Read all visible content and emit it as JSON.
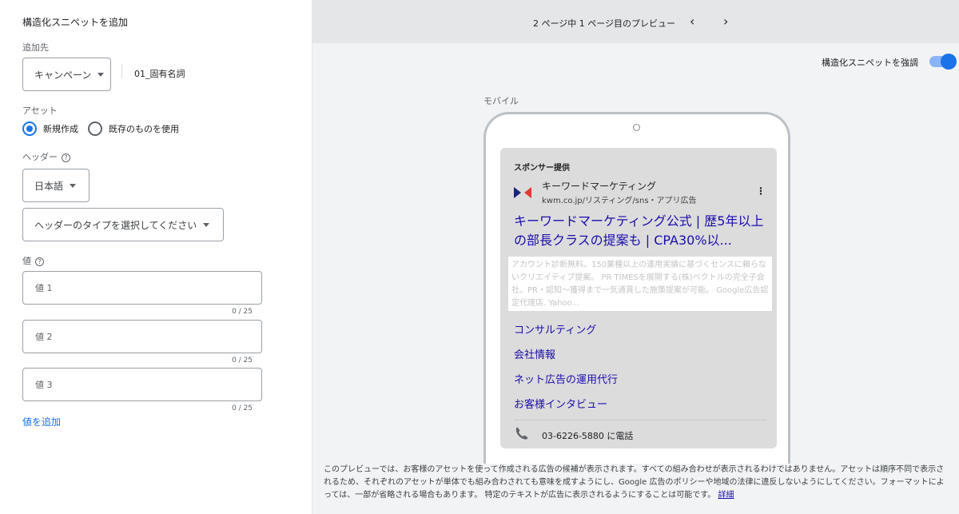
{
  "left": {
    "title": "構造化スニペットを追加",
    "destination_label": "追加先",
    "destination_dropdown": "キャンペーン",
    "campaign_name": "01_固有名詞",
    "asset_label": "アセット",
    "radio_new": "新規作成",
    "radio_existing": "既存のものを使用",
    "header_label": "ヘッダー",
    "language": "日本語",
    "header_type_placeholder": "ヘッダーのタイプを選択してください",
    "value_label": "値",
    "values": [
      {
        "placeholder": "値 1",
        "counter": "0 / 25"
      },
      {
        "placeholder": "値 2",
        "counter": "0 / 25"
      },
      {
        "placeholder": "値 3",
        "counter": "0 / 25"
      }
    ],
    "add_value": "値を追加"
  },
  "preview": {
    "page_text": "2 ページ中 1 ページ目のプレビュー",
    "prev_icon": "chevron-left-icon",
    "next_icon": "chevron-right-icon",
    "toggle_label": "構造化スニペットを強調",
    "toggle_on": true,
    "mobile_label": "モバイル",
    "ad": {
      "sponsored": "スポンサー提供",
      "advertiser": "キーワードマーケティング",
      "url": "kwm.co.jp/リスティング/sns・アプリ広告",
      "headline": "キーワードマーケティング公式 | 歴5年以上の部長クラスの提案も | CPA30%以...",
      "description": "アカウント診断無料。150業種以上の運用実績に基づくセンスに頼らないクリエイティブ提案。 PR TIMESを展開する(株)ベクトルの完全子会社。PR・認知〜獲得まで一気通貫した施策提案が可能。 Google広告認定代理店. Yahoo...",
      "snippets": [
        "コンサルティング",
        "会社情報",
        "ネット広告の運用代行",
        "お客様インタビュー"
      ],
      "phone": "03-6226-5880 に電話"
    },
    "disclaimer": "このプレビューでは、お客様のアセットを使って作成される広告の候補が表示されます。すべての組み合わせが表示されるわけではありません。アセットは順序不同で表示されるため、それぞれのアセットが単体でも組み合わされても意味を成すようにし、Google 広告のポリシーや地域の法律に違反しないようにしてください。フォーマットによっては、一部が省略される場合もあります。 特定のテキストが広告に表示されるようにすることは可能です。",
    "disclaimer_link": "詳細"
  },
  "colors": {
    "accent": "#1a73e8",
    "link": "#1a0dab",
    "panel_bg": "#f1f3f4"
  }
}
